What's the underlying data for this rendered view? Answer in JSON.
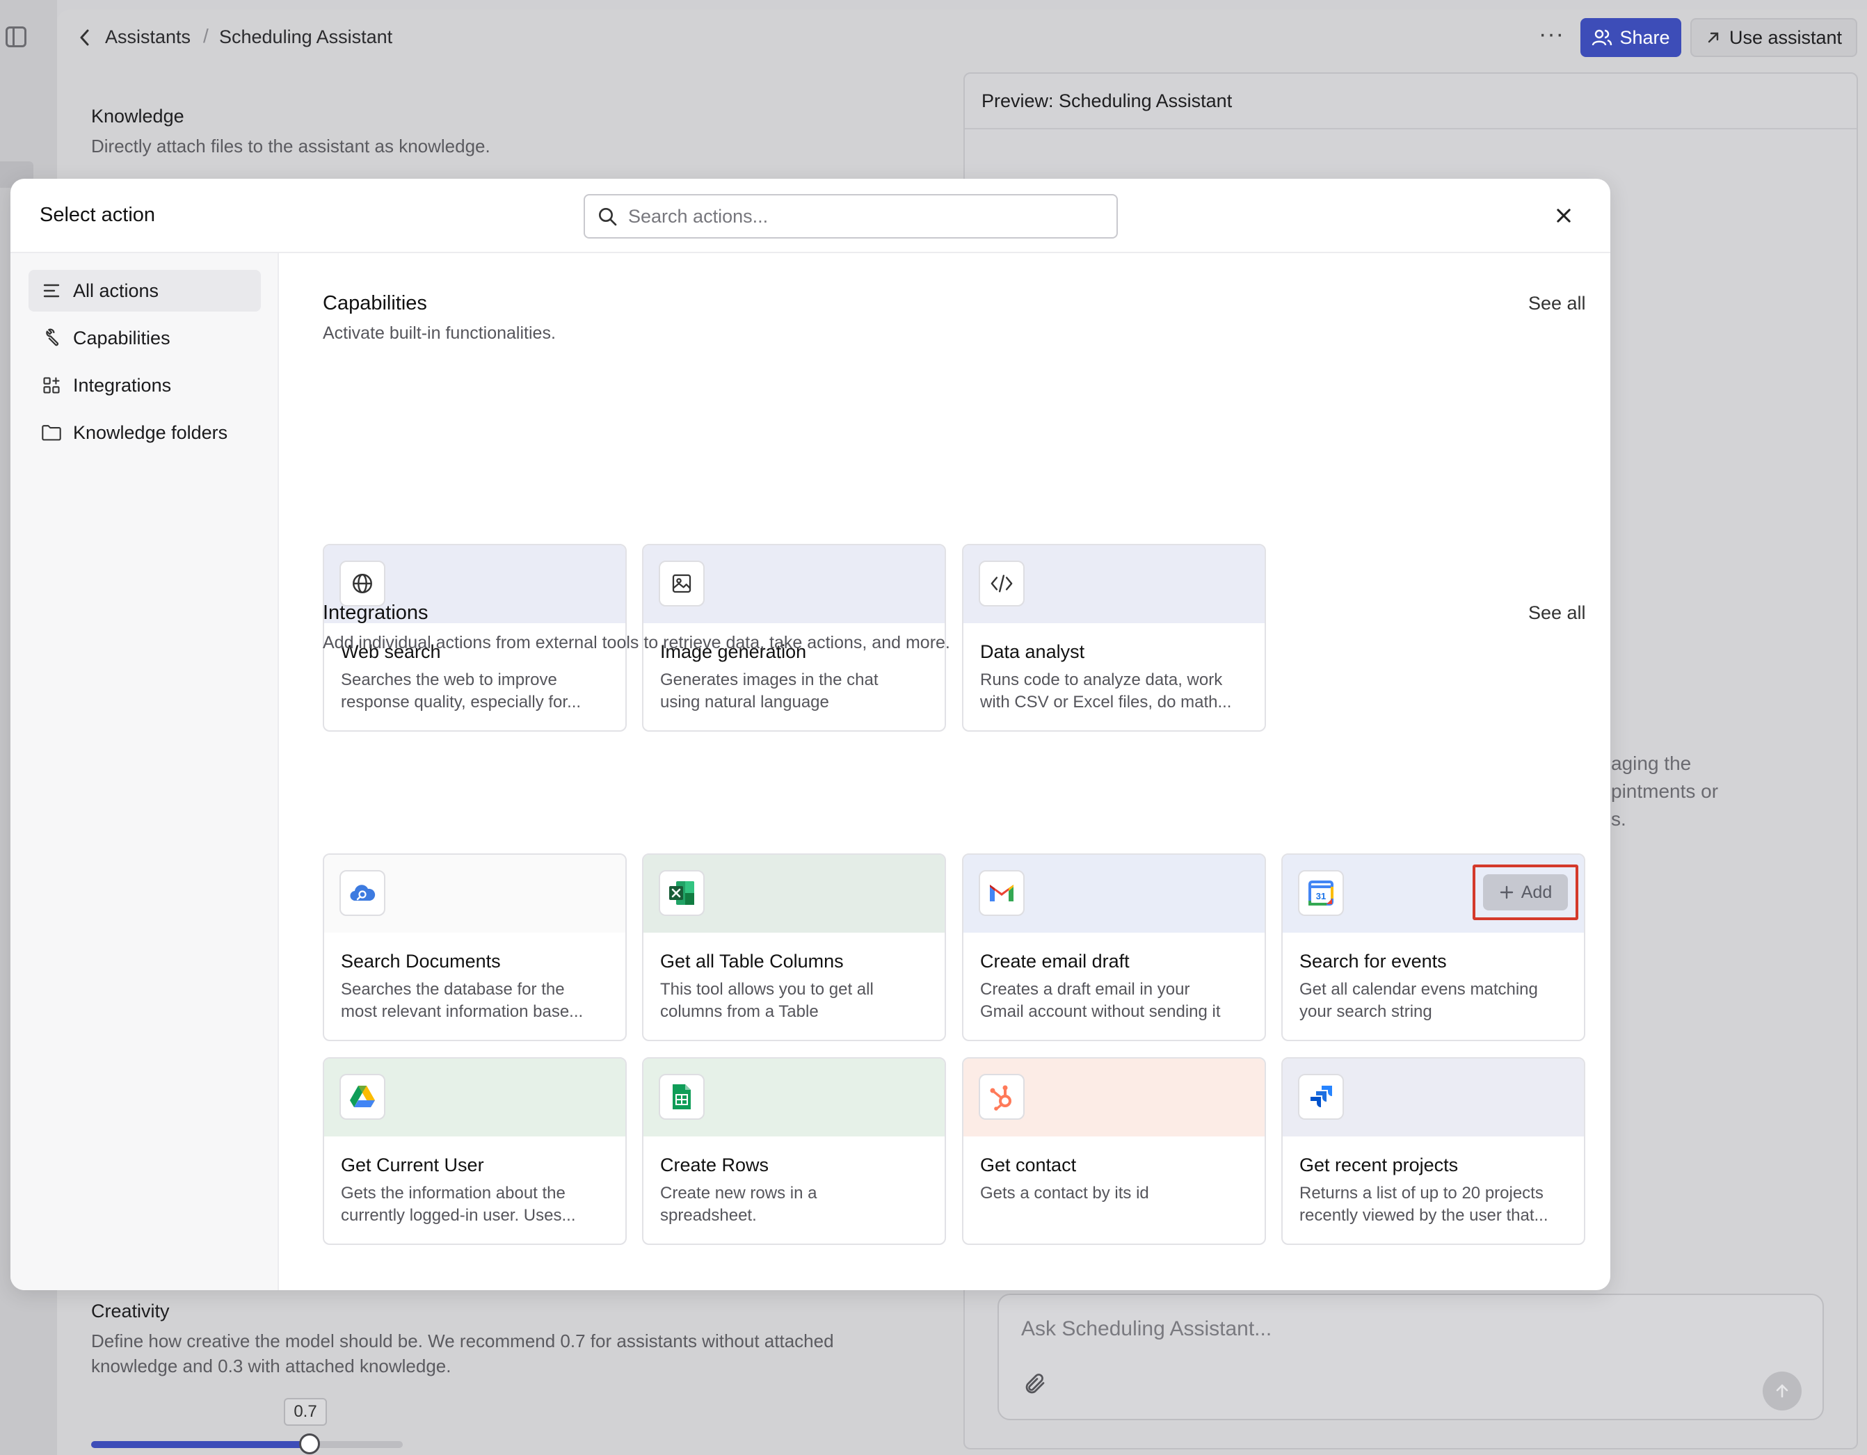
{
  "topbar": {
    "breadcrumb_root": "Assistants",
    "breadcrumb_separator": "/",
    "breadcrumb_current": "Scheduling Assistant",
    "more_label": "···",
    "share_label": "Share",
    "use_label": "Use assistant"
  },
  "background": {
    "knowledge_title": "Knowledge",
    "knowledge_sub": "Directly attach files to the assistant as knowledge.",
    "creativity_title": "Creativity",
    "creativity_sub_1": "Define how creative the model should be. We recommend 0.7 for assistants without attached",
    "creativity_sub_2": "knowledge and 0.3 with attached knowledge.",
    "slider_value_label": "0.7",
    "slider_fraction": 0.7,
    "preview_title": "Preview: Scheduling Assistant",
    "preview_partial_1": "aging the",
    "preview_partial_2": "pintments or",
    "preview_partial_3": "s.",
    "ask_placeholder": "Ask Scheduling Assistant..."
  },
  "modal": {
    "title": "Select action",
    "search_placeholder": "Search actions...",
    "nav": [
      {
        "label": "All actions",
        "icon": "list-icon",
        "active": true
      },
      {
        "label": "Capabilities",
        "icon": "wrench-icon",
        "active": false
      },
      {
        "label": "Integrations",
        "icon": "apps-add-icon",
        "active": false
      },
      {
        "label": "Knowledge folders",
        "icon": "folder-icon",
        "active": false
      }
    ],
    "capabilities": {
      "title": "Capabilities",
      "subtitle": "Activate built-in functionalities.",
      "see_all": "See all",
      "cards": [
        {
          "title": "Web search",
          "desc_1": "Searches the web to improve",
          "desc_2": "response quality, especially for...",
          "icon": "globe-icon",
          "band": "#eaecf6"
        },
        {
          "title": "Image generation",
          "desc_1": "Generates images in the chat",
          "desc_2": "using natural language",
          "icon": "image-icon",
          "band": "#eaecf6"
        },
        {
          "title": "Data analyst",
          "desc_1": "Runs code to analyze data, work",
          "desc_2": "with CSV or Excel files, do math...",
          "icon": "code-icon",
          "band": "#eaecf6"
        }
      ]
    },
    "integrations": {
      "title": "Integrations",
      "subtitle": "Add individual actions from external tools to retrieve data, take actions, and more.",
      "see_all": "See all",
      "add_label": "Add",
      "cards": [
        {
          "title": "Search Documents",
          "desc_1": "Searches the database for the",
          "desc_2": "most relevant information base...",
          "icon": "cloud-search-icon",
          "band": "#fafafa"
        },
        {
          "title": "Get all Table Columns",
          "desc_1": "This tool allows you to get all",
          "desc_2": "columns from a Table",
          "icon": "excel-icon",
          "band": "#e4ede7"
        },
        {
          "title": "Create email draft",
          "desc_1": "Creates a draft email in your",
          "desc_2": "Gmail account without sending it",
          "icon": "gmail-icon",
          "band": "#e9edf8"
        },
        {
          "title": "Search for events",
          "desc_1": "Get all calendar evens matching",
          "desc_2": "your search string",
          "icon": "google-calendar-icon",
          "band": "#e9edf8"
        },
        {
          "title": "Get Current User",
          "desc_1": "Gets the information about the",
          "desc_2": "currently logged-in user. Uses...",
          "icon": "google-drive-icon",
          "band": "#e6f1e8"
        },
        {
          "title": "Create Rows",
          "desc_1": "Create new rows in a",
          "desc_2": "spreadsheet.",
          "icon": "google-sheets-icon",
          "band": "#e6f1e8"
        },
        {
          "title": "Get contact",
          "desc_1": "Gets a contact by its id",
          "desc_2": "",
          "icon": "hubspot-icon",
          "band": "#fcece6"
        },
        {
          "title": "Get recent projects",
          "desc_1": "Returns a list of up to 20 projects",
          "desc_2": "recently viewed by the user that...",
          "icon": "jira-icon",
          "band": "#ebecf4"
        }
      ]
    }
  }
}
